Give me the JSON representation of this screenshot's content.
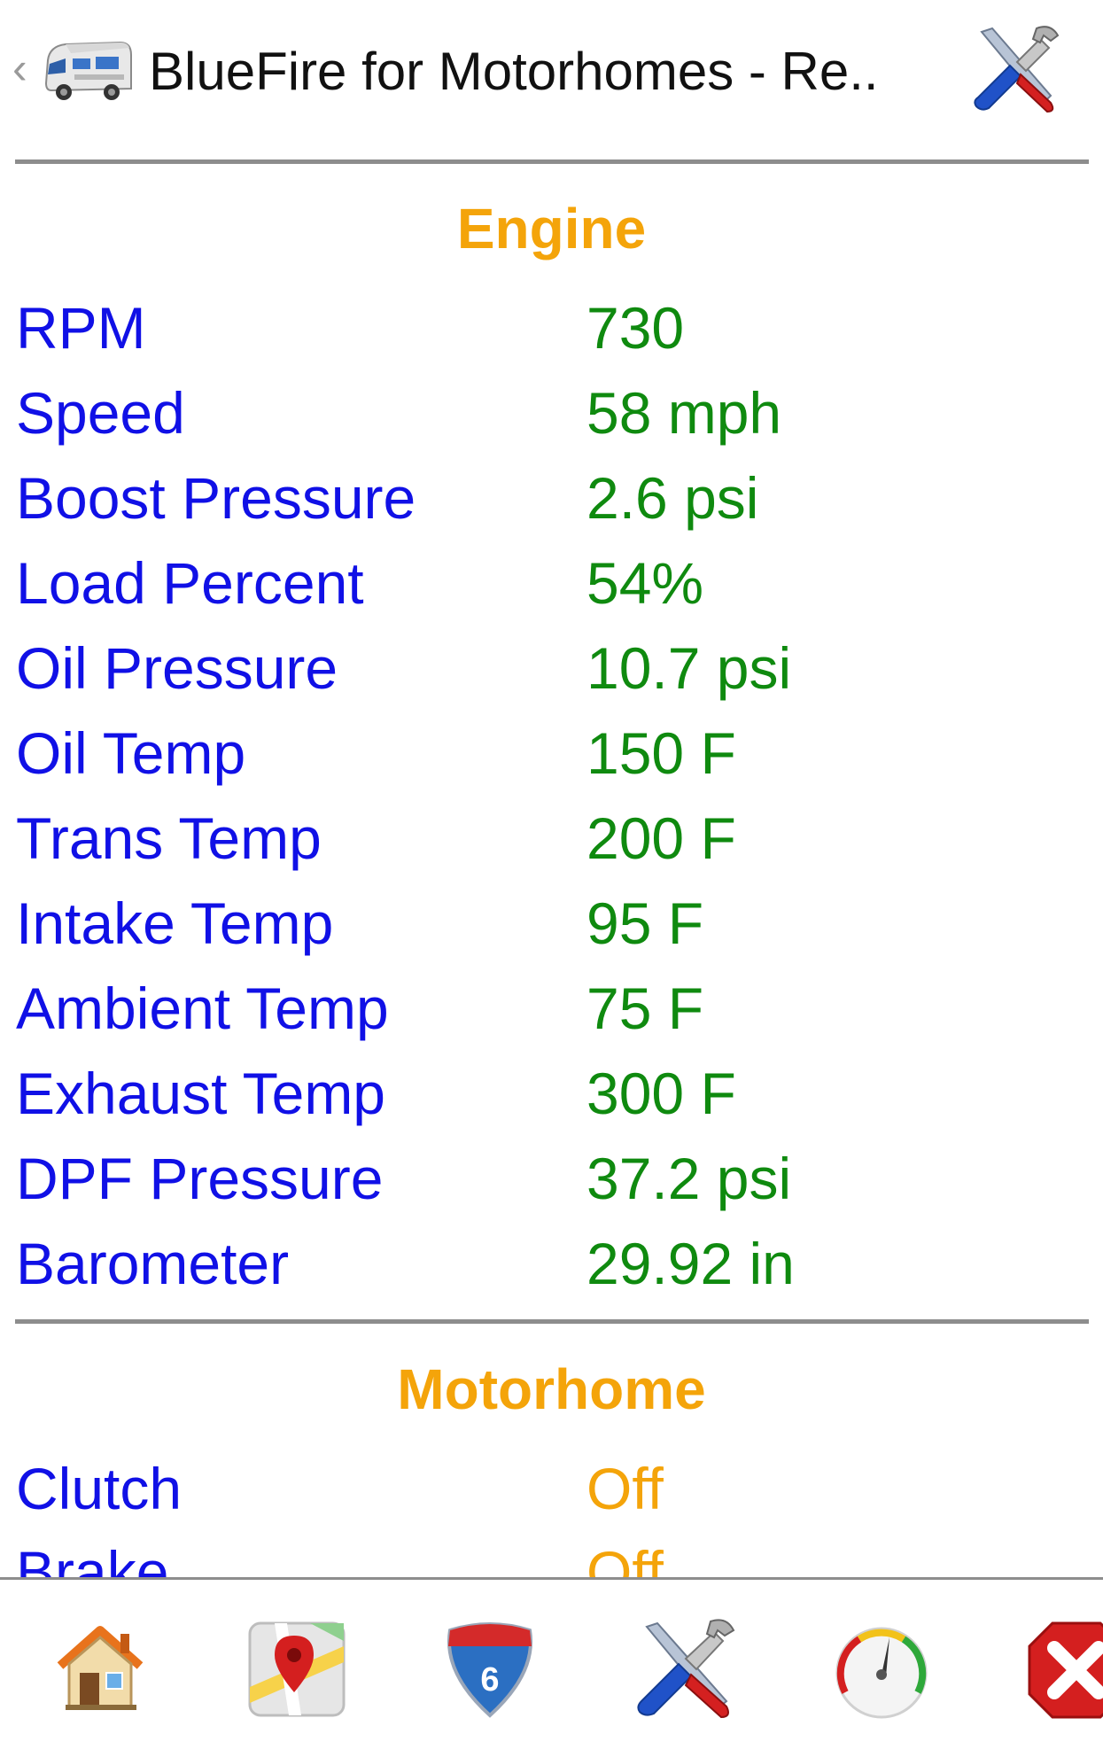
{
  "header": {
    "title": "BlueFire for Motorhomes - Re..",
    "back_glyph": "‹",
    "app_icon": "motorhome-icon",
    "settings_icon": "tools-icon"
  },
  "sections": [
    {
      "title": "Engine",
      "rows": [
        {
          "label": "RPM",
          "value": "730"
        },
        {
          "label": "Speed",
          "value": "58 mph"
        },
        {
          "label": "Boost Pressure",
          "value": "2.6 psi"
        },
        {
          "label": "Load Percent",
          "value": "54%"
        },
        {
          "label": "Oil Pressure",
          "value": "10.7 psi"
        },
        {
          "label": "Oil Temp",
          "value": "150 F"
        },
        {
          "label": "Trans Temp",
          "value": "200 F"
        },
        {
          "label": "Intake Temp",
          "value": "95 F"
        },
        {
          "label": "Ambient Temp",
          "value": "75 F"
        },
        {
          "label": "Exhaust Temp",
          "value": "300 F"
        },
        {
          "label": "DPF Pressure",
          "value": "37.2 psi"
        },
        {
          "label": "Barometer",
          "value": "29.92 in"
        }
      ]
    },
    {
      "title": "Motorhome",
      "rows": [
        {
          "label": "Clutch",
          "value": "Off"
        },
        {
          "label": "Brake",
          "value": "Off"
        }
      ]
    }
  ],
  "toolbar": {
    "items": [
      {
        "icon": "home-icon"
      },
      {
        "icon": "map-icon"
      },
      {
        "icon": "interstate-6-icon",
        "badge": "6"
      },
      {
        "icon": "tools-icon"
      },
      {
        "icon": "gauge-icon"
      },
      {
        "icon": "close-icon"
      }
    ]
  },
  "colors": {
    "label": "#1010e6",
    "value": "#0f8a0f",
    "section_title": "#f4a40a",
    "status_value": "#f4a40a",
    "divider": "#8d8d8d"
  }
}
